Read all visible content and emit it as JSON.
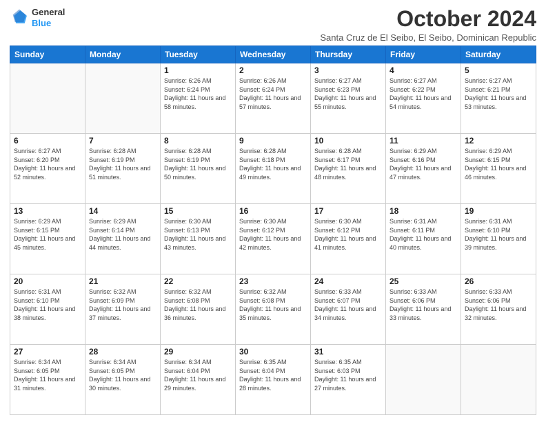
{
  "logo": {
    "line1": "General",
    "line2": "Blue"
  },
  "title": "October 2024",
  "subtitle": "Santa Cruz de El Seibo, El Seibo, Dominican Republic",
  "headers": [
    "Sunday",
    "Monday",
    "Tuesday",
    "Wednesday",
    "Thursday",
    "Friday",
    "Saturday"
  ],
  "weeks": [
    [
      {
        "day": "",
        "info": ""
      },
      {
        "day": "",
        "info": ""
      },
      {
        "day": "1",
        "info": "Sunrise: 6:26 AM\nSunset: 6:24 PM\nDaylight: 11 hours and 58 minutes."
      },
      {
        "day": "2",
        "info": "Sunrise: 6:26 AM\nSunset: 6:24 PM\nDaylight: 11 hours and 57 minutes."
      },
      {
        "day": "3",
        "info": "Sunrise: 6:27 AM\nSunset: 6:23 PM\nDaylight: 11 hours and 55 minutes."
      },
      {
        "day": "4",
        "info": "Sunrise: 6:27 AM\nSunset: 6:22 PM\nDaylight: 11 hours and 54 minutes."
      },
      {
        "day": "5",
        "info": "Sunrise: 6:27 AM\nSunset: 6:21 PM\nDaylight: 11 hours and 53 minutes."
      }
    ],
    [
      {
        "day": "6",
        "info": "Sunrise: 6:27 AM\nSunset: 6:20 PM\nDaylight: 11 hours and 52 minutes."
      },
      {
        "day": "7",
        "info": "Sunrise: 6:28 AM\nSunset: 6:19 PM\nDaylight: 11 hours and 51 minutes."
      },
      {
        "day": "8",
        "info": "Sunrise: 6:28 AM\nSunset: 6:19 PM\nDaylight: 11 hours and 50 minutes."
      },
      {
        "day": "9",
        "info": "Sunrise: 6:28 AM\nSunset: 6:18 PM\nDaylight: 11 hours and 49 minutes."
      },
      {
        "day": "10",
        "info": "Sunrise: 6:28 AM\nSunset: 6:17 PM\nDaylight: 11 hours and 48 minutes."
      },
      {
        "day": "11",
        "info": "Sunrise: 6:29 AM\nSunset: 6:16 PM\nDaylight: 11 hours and 47 minutes."
      },
      {
        "day": "12",
        "info": "Sunrise: 6:29 AM\nSunset: 6:15 PM\nDaylight: 11 hours and 46 minutes."
      }
    ],
    [
      {
        "day": "13",
        "info": "Sunrise: 6:29 AM\nSunset: 6:15 PM\nDaylight: 11 hours and 45 minutes."
      },
      {
        "day": "14",
        "info": "Sunrise: 6:29 AM\nSunset: 6:14 PM\nDaylight: 11 hours and 44 minutes."
      },
      {
        "day": "15",
        "info": "Sunrise: 6:30 AM\nSunset: 6:13 PM\nDaylight: 11 hours and 43 minutes."
      },
      {
        "day": "16",
        "info": "Sunrise: 6:30 AM\nSunset: 6:12 PM\nDaylight: 11 hours and 42 minutes."
      },
      {
        "day": "17",
        "info": "Sunrise: 6:30 AM\nSunset: 6:12 PM\nDaylight: 11 hours and 41 minutes."
      },
      {
        "day": "18",
        "info": "Sunrise: 6:31 AM\nSunset: 6:11 PM\nDaylight: 11 hours and 40 minutes."
      },
      {
        "day": "19",
        "info": "Sunrise: 6:31 AM\nSunset: 6:10 PM\nDaylight: 11 hours and 39 minutes."
      }
    ],
    [
      {
        "day": "20",
        "info": "Sunrise: 6:31 AM\nSunset: 6:10 PM\nDaylight: 11 hours and 38 minutes."
      },
      {
        "day": "21",
        "info": "Sunrise: 6:32 AM\nSunset: 6:09 PM\nDaylight: 11 hours and 37 minutes."
      },
      {
        "day": "22",
        "info": "Sunrise: 6:32 AM\nSunset: 6:08 PM\nDaylight: 11 hours and 36 minutes."
      },
      {
        "day": "23",
        "info": "Sunrise: 6:32 AM\nSunset: 6:08 PM\nDaylight: 11 hours and 35 minutes."
      },
      {
        "day": "24",
        "info": "Sunrise: 6:33 AM\nSunset: 6:07 PM\nDaylight: 11 hours and 34 minutes."
      },
      {
        "day": "25",
        "info": "Sunrise: 6:33 AM\nSunset: 6:06 PM\nDaylight: 11 hours and 33 minutes."
      },
      {
        "day": "26",
        "info": "Sunrise: 6:33 AM\nSunset: 6:06 PM\nDaylight: 11 hours and 32 minutes."
      }
    ],
    [
      {
        "day": "27",
        "info": "Sunrise: 6:34 AM\nSunset: 6:05 PM\nDaylight: 11 hours and 31 minutes."
      },
      {
        "day": "28",
        "info": "Sunrise: 6:34 AM\nSunset: 6:05 PM\nDaylight: 11 hours and 30 minutes."
      },
      {
        "day": "29",
        "info": "Sunrise: 6:34 AM\nSunset: 6:04 PM\nDaylight: 11 hours and 29 minutes."
      },
      {
        "day": "30",
        "info": "Sunrise: 6:35 AM\nSunset: 6:04 PM\nDaylight: 11 hours and 28 minutes."
      },
      {
        "day": "31",
        "info": "Sunrise: 6:35 AM\nSunset: 6:03 PM\nDaylight: 11 hours and 27 minutes."
      },
      {
        "day": "",
        "info": ""
      },
      {
        "day": "",
        "info": ""
      }
    ]
  ]
}
